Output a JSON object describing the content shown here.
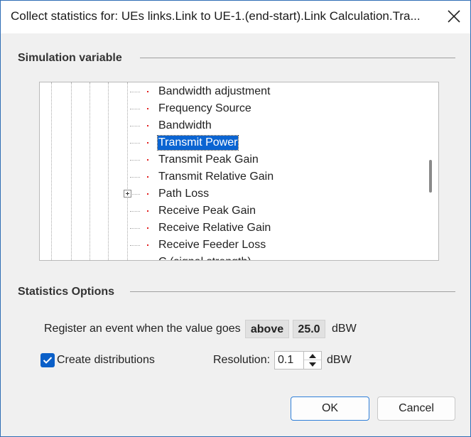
{
  "window": {
    "title": "Collect statistics for: UEs links.Link to UE-1.(end-start).Link Calculation.Tra..."
  },
  "simulation_section": {
    "header": "Simulation variable",
    "tree_items": [
      {
        "label": "Bandwidth adjustment",
        "selected": false,
        "expandable": false
      },
      {
        "label": "Frequency Source",
        "selected": false,
        "expandable": false
      },
      {
        "label": "Bandwidth",
        "selected": false,
        "expandable": false
      },
      {
        "label": "Transmit Power",
        "selected": true,
        "expandable": false
      },
      {
        "label": "Transmit Peak Gain",
        "selected": false,
        "expandable": false
      },
      {
        "label": "Transmit Relative Gain",
        "selected": false,
        "expandable": false
      },
      {
        "label": "Path Loss",
        "selected": false,
        "expandable": true
      },
      {
        "label": "Receive Peak Gain",
        "selected": false,
        "expandable": false
      },
      {
        "label": "Receive Relative Gain",
        "selected": false,
        "expandable": false
      },
      {
        "label": "Receive Feeder Loss",
        "selected": false,
        "expandable": false
      },
      {
        "label": "C (signal strength)",
        "selected": false,
        "expandable": false
      }
    ]
  },
  "statistics_section": {
    "header": "Statistics Options",
    "event_label": "Register an event when the value goes",
    "event_direction": "above",
    "event_threshold": "25.0",
    "event_unit": "dBW",
    "create_distributions_label": "Create distributions",
    "create_distributions_checked": true,
    "resolution_label": "Resolution:",
    "resolution_value": "0.1",
    "resolution_unit": "dBW"
  },
  "buttons": {
    "ok_label": "OK",
    "cancel_label": "Cancel"
  },
  "colors": {
    "accent": "#0a64d2",
    "bullet": "#e21e1e"
  }
}
